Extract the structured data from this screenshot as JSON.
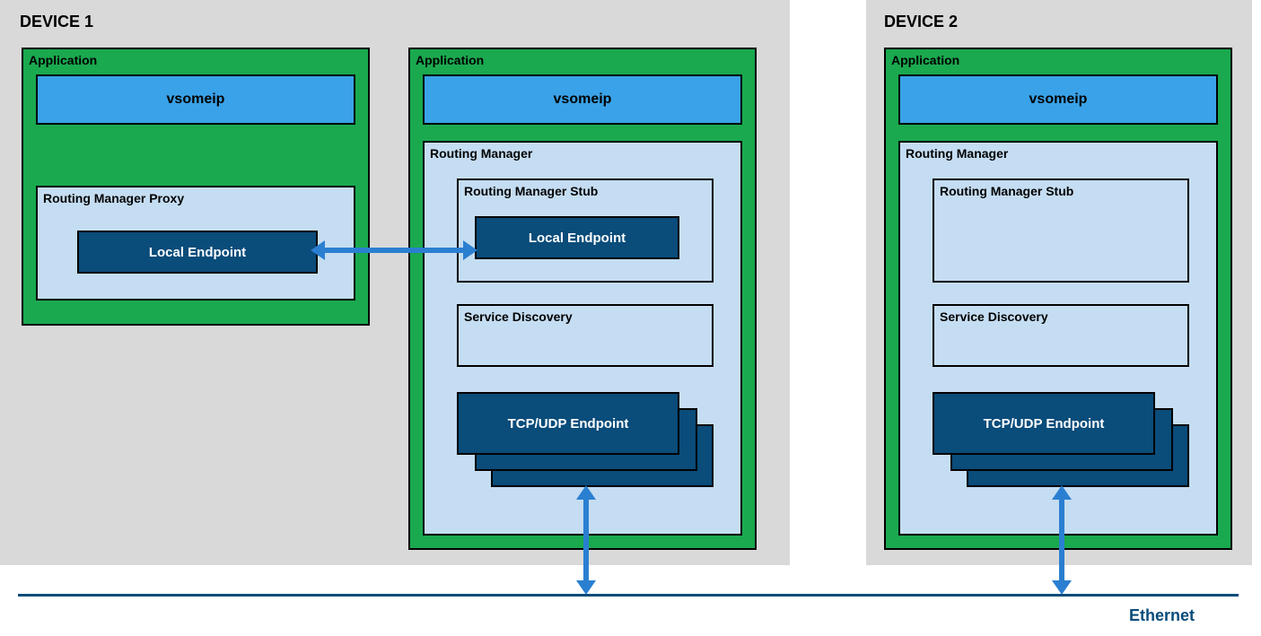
{
  "device1": {
    "title": "DEVICE 1",
    "app1": {
      "label": "Application",
      "vsomeip": "vsomeip",
      "rmp": {
        "label": "Routing Manager Proxy",
        "local_ep": "Local Endpoint"
      }
    },
    "app2": {
      "label": "Application",
      "vsomeip": "vsomeip",
      "rm": {
        "label": "Routing Manager",
        "rms": {
          "label": "Routing Manager Stub",
          "local_ep": "Local Endpoint"
        },
        "sd": "Service Discovery",
        "tcpudp": "TCP/UDP Endpoint"
      }
    }
  },
  "device2": {
    "title": "DEVICE 2",
    "app": {
      "label": "Application",
      "vsomeip": "vsomeip",
      "rm": {
        "label": "Routing Manager",
        "rms": {
          "label": "Routing Manager Stub"
        },
        "sd": "Service Discovery",
        "tcpudp": "TCP/UDP Endpoint"
      }
    }
  },
  "ethernet": "Ethernet"
}
